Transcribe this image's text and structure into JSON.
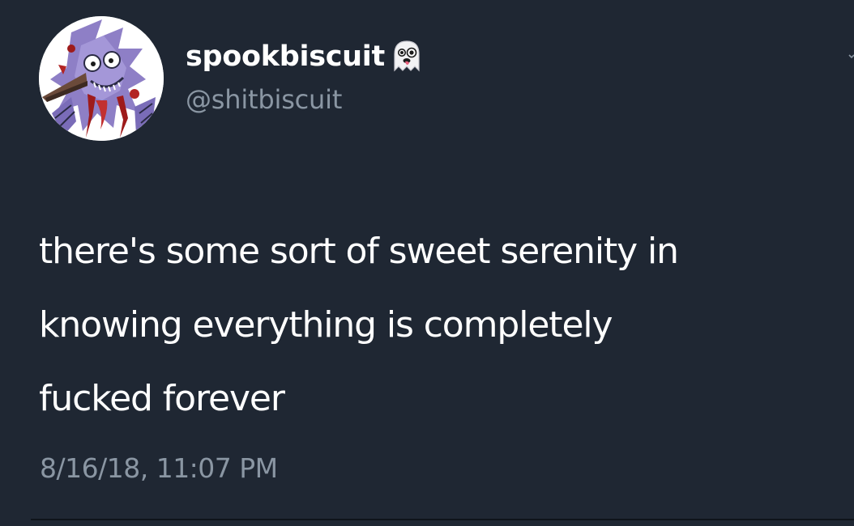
{
  "user": {
    "display_name": "spookbiscuit",
    "display_name_emoji": "ghost-icon",
    "handle": "@shitbiscuit",
    "avatar": "avatar-cartoon-bird"
  },
  "tweet": {
    "lines": [
      "there's some sort of sweet serenity in",
      "knowing everything is completely",
      "fucked forever"
    ],
    "timestamp": "8/16/18, 11:07 PM"
  },
  "colors": {
    "background": "#1f2733",
    "primary_text": "#ffffff",
    "secondary_text": "#8a96a3",
    "divider": "#0f141b"
  }
}
